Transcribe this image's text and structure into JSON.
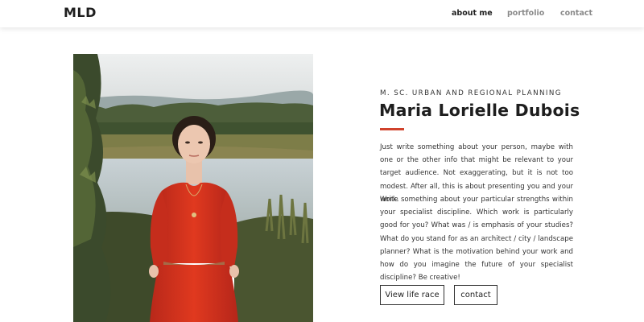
{
  "nav": {
    "brand": "MLD",
    "items": [
      {
        "label": "about me",
        "active": true
      },
      {
        "label": "portfolio",
        "active": false
      },
      {
        "label": "contact",
        "active": false
      }
    ]
  },
  "profile": {
    "subtitle": "M. SC. URBAN AND REGIONAL PLANNING",
    "name": "Maria Lorielle Dubois",
    "paragraphs": [
      "Just write something about your person, maybe with one or the other info that might be relevant to your target audience. Not exaggerating, but it is not too modest. After all, this is about presenting you and your work.",
      "Write something about your particular strengths within your specialist discipline. Which work is particularly good for you? What was / is emphasis of your studies? What do you stand for as an architect / city / landscape planner? What is the motivation behind your work and how do you imagine the future of your specialist discipline? Be creative!"
    ],
    "buttons": {
      "life": "View life race",
      "contact": "contact"
    }
  },
  "colors": {
    "accent": "#d0422c",
    "dress": "#d9331f",
    "text": "#222222"
  }
}
